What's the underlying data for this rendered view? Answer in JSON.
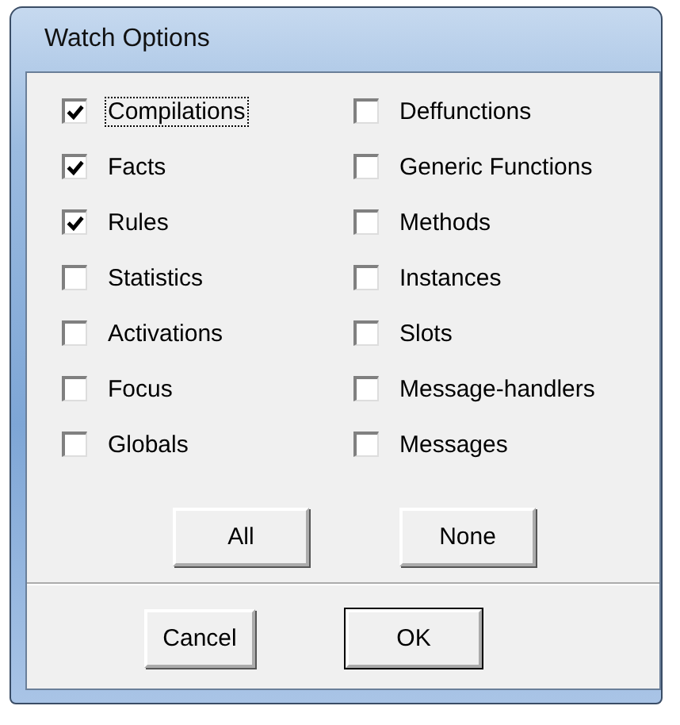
{
  "window": {
    "title": "Watch Options"
  },
  "options": [
    {
      "label": "Compilations",
      "checked": true,
      "focused": true
    },
    {
      "label": "Facts",
      "checked": true,
      "focused": false
    },
    {
      "label": "Rules",
      "checked": true,
      "focused": false
    },
    {
      "label": "Statistics",
      "checked": false,
      "focused": false
    },
    {
      "label": "Activations",
      "checked": false,
      "focused": false
    },
    {
      "label": "Focus",
      "checked": false,
      "focused": false
    },
    {
      "label": "Globals",
      "checked": false,
      "focused": false
    },
    {
      "label": "Deffunctions",
      "checked": false,
      "focused": false
    },
    {
      "label": "Generic Functions",
      "checked": false,
      "focused": false
    },
    {
      "label": "Methods",
      "checked": false,
      "focused": false
    },
    {
      "label": "Instances",
      "checked": false,
      "focused": false
    },
    {
      "label": "Slots",
      "checked": false,
      "focused": false
    },
    {
      "label": "Message-handlers",
      "checked": false,
      "focused": false
    },
    {
      "label": "Messages",
      "checked": false,
      "focused": false
    }
  ],
  "select_buttons": [
    {
      "label": "All",
      "default": false
    },
    {
      "label": "None",
      "default": false
    }
  ],
  "buttons": [
    {
      "label": "Cancel",
      "default": false
    },
    {
      "label": "OK",
      "default": true
    }
  ]
}
